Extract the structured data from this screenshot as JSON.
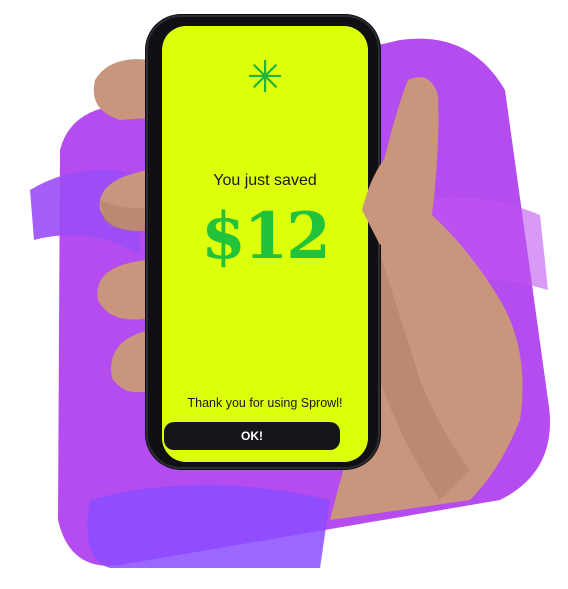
{
  "app": {
    "name": "Sprowl"
  },
  "screen": {
    "icon": "asterisk-icon",
    "icon_glyph": "✳",
    "saved_label": "You just saved",
    "amount": "$12",
    "thanks_text": "Thank you for using Sprowl!",
    "ok_label": "OK!"
  },
  "colors": {
    "screen_background": "#dcff0c",
    "accent_green": "#22c23a",
    "button_background": "#15151c",
    "backdrop_purple": "#b44cf0",
    "backdrop_violet": "#8a4cff"
  }
}
